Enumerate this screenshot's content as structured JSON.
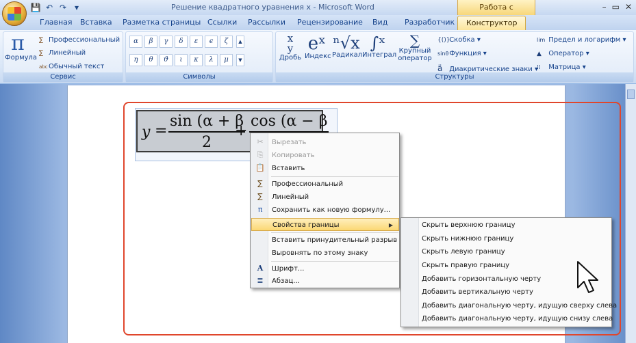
{
  "window": {
    "title": "Решение квадратного уравнения х - Microsoft Word",
    "context_title": "Работа с формулами",
    "controls": [
      "–",
      "▭",
      "✕"
    ]
  },
  "qat": [
    "💾",
    "↶",
    "↷",
    "▾"
  ],
  "tabs": [
    {
      "label": "Главная"
    },
    {
      "label": "Вставка"
    },
    {
      "label": "Разметка страницы"
    },
    {
      "label": "Ссылки"
    },
    {
      "label": "Рассылки"
    },
    {
      "label": "Рецензирование"
    },
    {
      "label": "Вид"
    },
    {
      "label": "Разработчик"
    },
    {
      "label": "Конструктор",
      "active": true
    }
  ],
  "ribbon": {
    "service": {
      "label": "Сервис",
      "formula": "Формула",
      "professional": "Профессиональный",
      "linear": "Линейный",
      "plain_text": "Обычный текст"
    },
    "symbols": {
      "label": "Символы",
      "row1": [
        "α",
        "β",
        "γ",
        "δ",
        "ε",
        "ϵ",
        "ζ"
      ],
      "row2": [
        "η",
        "θ",
        "ϑ",
        "ι",
        "κ",
        "λ",
        "μ"
      ]
    },
    "structures": {
      "label": "Структуры",
      "fraction": "Дробь",
      "index": "Индекс",
      "radical": "Радикал",
      "integral": "Интеграл",
      "large_operator_1": "Крупный",
      "large_operator_2": "оператор",
      "bracket": "Скобка",
      "function": "Функция",
      "accent": "Диакритические знаки",
      "limit": "Предел и логарифм",
      "operator": "Оператор",
      "matrix": "Матрица"
    }
  },
  "equation": {
    "lhs": "y",
    "eq": "=",
    "num1": "sin (α + β",
    "den1": "2",
    "plus": "+",
    "num2": "cos (α − β"
  },
  "context_menu": {
    "items": [
      {
        "label": "Вырезать",
        "icon": "✂",
        "disabled": true
      },
      {
        "label": "Копировать",
        "icon": "⎘",
        "disabled": true
      },
      {
        "label": "Вставить",
        "icon": "📋"
      },
      {
        "label": "Профессиональный",
        "icon": "∑"
      },
      {
        "label": "Линейный",
        "icon": "∑"
      },
      {
        "label": "Сохранить как новую формулу...",
        "icon": "π"
      },
      {
        "label": "Свойства границы",
        "highlighted": true,
        "submenu": true
      },
      {
        "label": "Вставить принудительный разрыв"
      },
      {
        "label": "Выровнять по этому знаку"
      },
      {
        "label": "Шрифт...",
        "icon": "A"
      },
      {
        "label": "Абзац...",
        "icon": "≣"
      }
    ]
  },
  "submenu": {
    "items": [
      "Скрыть верхнюю границу",
      "Скрыть нижнюю границу",
      "Скрыть левую границу",
      "Скрыть правую границу",
      "Добавить горизонтальную черту",
      "Добавить вертикальную черту",
      "Добавить диагональную черту, идущую сверху слева",
      "Добавить диагональную черту, идущую снизу слева"
    ]
  },
  "colors": {
    "highlight_frame": "#e0462c",
    "ribbon_text": "#15428b",
    "active_tab": "#fbe59c"
  }
}
